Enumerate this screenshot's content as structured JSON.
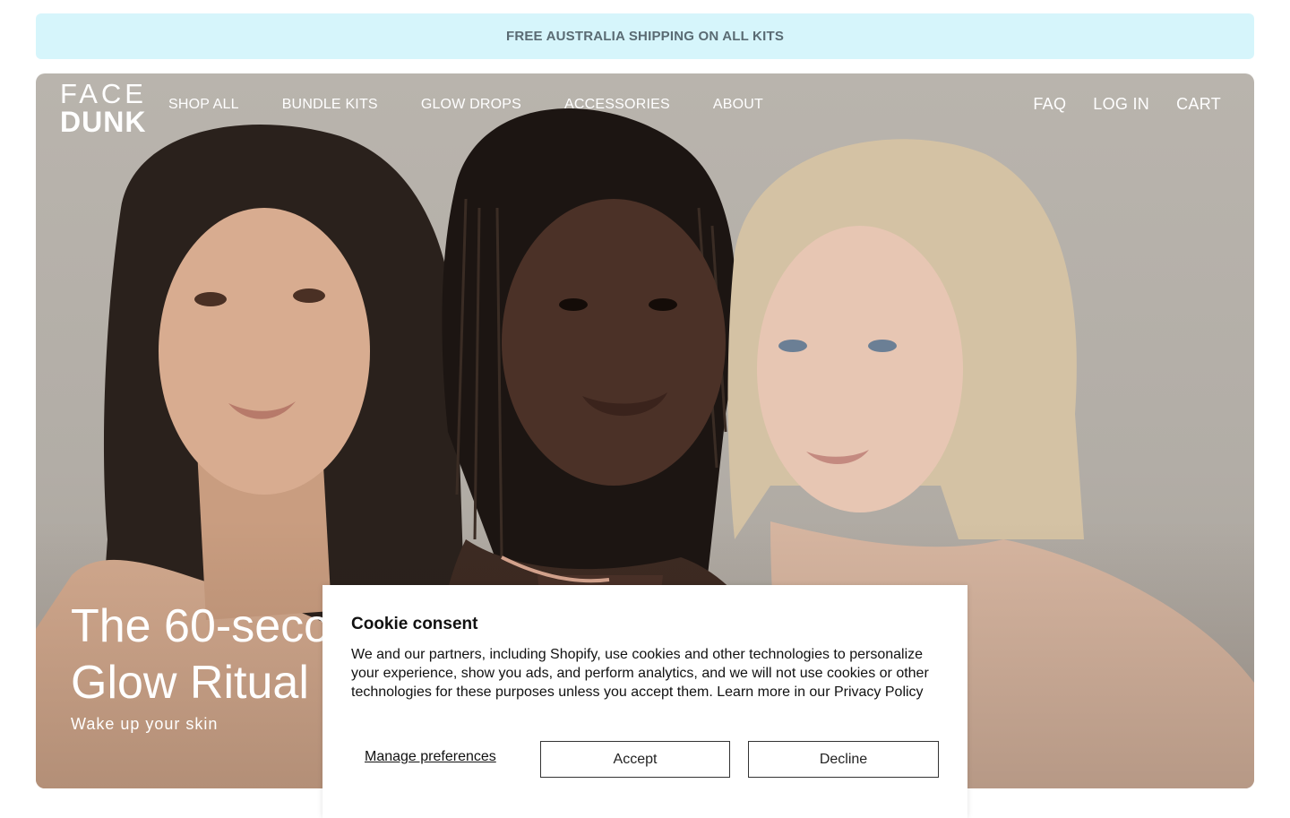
{
  "announcement": {
    "text": "FREE AUSTRALIA SHIPPING ON ALL KITS"
  },
  "header": {
    "logo_line1": "FACE",
    "logo_line2": "DUNK",
    "nav": [
      "SHOP ALL",
      "BUNDLE KITS",
      "GLOW DROPS",
      "ACCESSORIES",
      "ABOUT"
    ],
    "nav_right": [
      "FAQ",
      "LOG IN",
      "CART"
    ]
  },
  "hero": {
    "headline_line1": "The 60-seco",
    "headline_line2": "Glow Ritual",
    "subheading": "Wake up your skin"
  },
  "cookie": {
    "title": "Cookie consent",
    "body": "We and our partners, including Shopify, use cookies and other technologies to personalize your experience, show you ads, and perform analytics, and we will not use cookies or other technologies for these purposes unless you accept them. Learn more in our Privacy Policy",
    "manage_label": "Manage preferences",
    "accept_label": "Accept",
    "decline_label": "Decline"
  },
  "colors": {
    "announcement_bg": "#d6f5fb",
    "hero_bg": "#b5b0a9"
  }
}
